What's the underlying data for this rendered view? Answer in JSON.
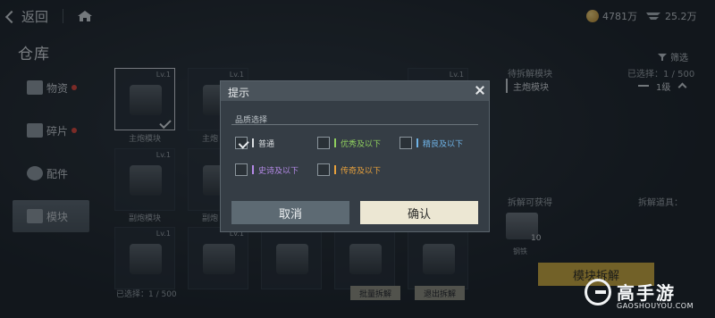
{
  "header": {
    "back_label": "返回",
    "coins": "4781万",
    "wings": "25.2万"
  },
  "page": {
    "title": "仓库",
    "filter_label": "筛选"
  },
  "sidebar": {
    "items": [
      {
        "label": "物资"
      },
      {
        "label": "碎片"
      },
      {
        "label": "配件"
      },
      {
        "label": "模块"
      }
    ]
  },
  "grid": {
    "level_label": "Lv.1",
    "rows": [
      {
        "cells": [
          "主炮模块",
          "主炮",
          "",
          "",
          "",
          ""
        ]
      },
      {
        "cells": [
          "副炮模块",
          "副炮",
          "",
          "",
          "",
          ""
        ]
      },
      {
        "cells": [
          "",
          "",
          "",
          "",
          "",
          ""
        ]
      }
    ],
    "selected_count": "已选择：1 / 500",
    "bulk_dismantle": "批量拆解",
    "exit_dismantle": "退出拆解"
  },
  "right_panel": {
    "pending_title": "待拆解模块",
    "pending_count": "已选择：1 / 500",
    "pending_item": "主炮模块",
    "pending_level": "1级",
    "yield_title": "拆解可获得",
    "yield_hint": "拆解道具：",
    "yield_qty": "10",
    "yield_name": "钢铁",
    "dismantle_button": "模块拆解"
  },
  "dialog": {
    "title": "提示",
    "section_label": "品质选择",
    "options": [
      {
        "label": "普通",
        "checked": true,
        "color": "#d9dde0"
      },
      {
        "label": "优秀及以下",
        "checked": false,
        "color": "#8fcf5e"
      },
      {
        "label": "精良及以下",
        "checked": false,
        "color": "#6fb4e8"
      },
      {
        "label": "史诗及以下",
        "checked": false,
        "color": "#b58ae8"
      },
      {
        "label": "传奇及以下",
        "checked": false,
        "color": "#e8a13c"
      }
    ],
    "cancel_label": "取消",
    "confirm_label": "确认"
  },
  "watermark": {
    "brand": "高手游",
    "url": "GAOSHOUYOU.COM"
  }
}
